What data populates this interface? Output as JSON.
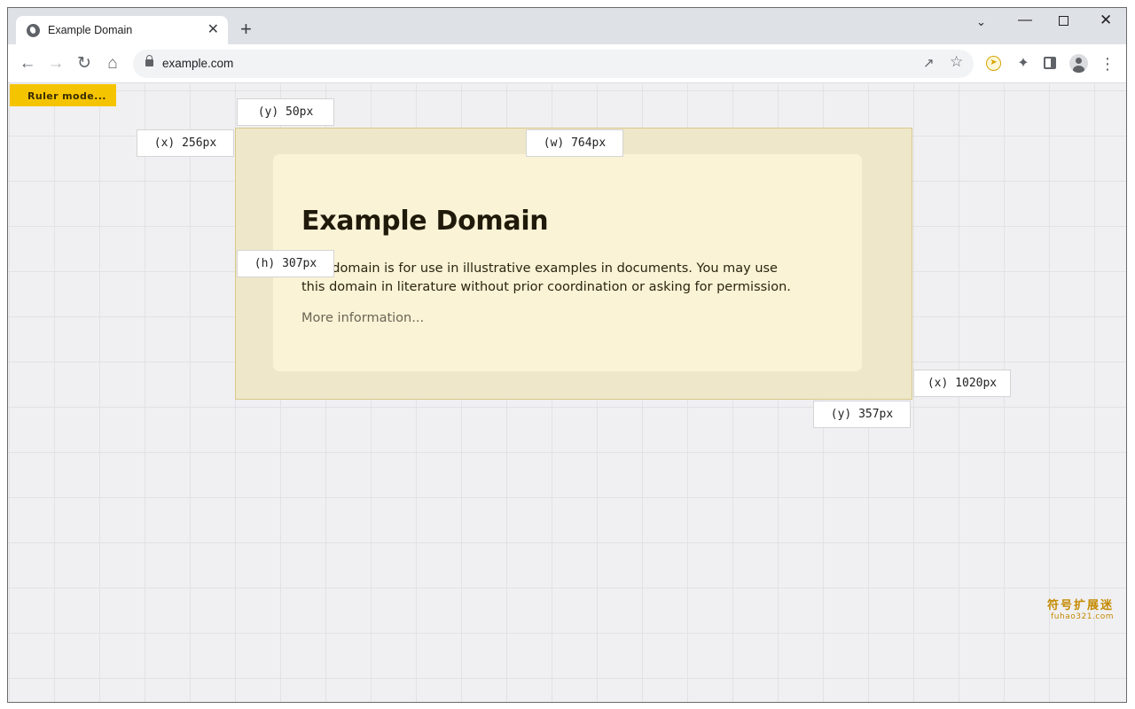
{
  "browser": {
    "tab_title": "Example Domain",
    "new_tab_symbol": "+",
    "close_symbol": "✕",
    "url": "example.com",
    "icons": [
      "globe-icon",
      "back-arrow-icon",
      "forward-arrow-icon",
      "reload-icon",
      "home-icon",
      "lock-icon",
      "share-icon",
      "star-icon",
      "compass-extension-icon",
      "puzzle-extension-icon",
      "side-panel-icon",
      "profile-icon",
      "menu-icon"
    ]
  },
  "ruler": {
    "button_label": "Ruler mode...",
    "labels": {
      "y_top": "(y) 50px",
      "x_left": "(x) 256px",
      "width": "(w) 764px",
      "height": "(h) 307px",
      "x_right": "(x) 1020px",
      "y_bottom": "(y) 357px"
    },
    "highlight_color": "#eee7c9"
  },
  "page": {
    "heading": "Example Domain",
    "paragraph": "This domain is for use in illustrative examples in documents. You may use this domain in literature without prior coordination or asking for permission.",
    "link": "More information..."
  },
  "watermark": {
    "line1": "符号扩展迷",
    "line2": "fuhao321.com"
  }
}
